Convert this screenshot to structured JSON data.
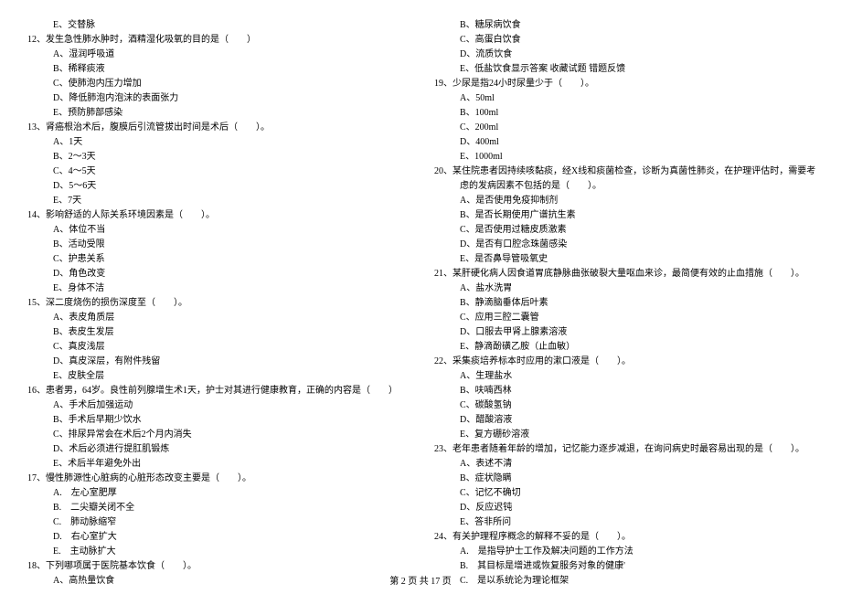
{
  "left_column": [
    {
      "type": "option",
      "text": "E、交替脉"
    },
    {
      "type": "question",
      "text": "12、发生急性肺水肿时，酒精湿化吸氧的目的是（　　）"
    },
    {
      "type": "option",
      "text": "A、湿润呼吸道"
    },
    {
      "type": "option",
      "text": "B、稀释痰液"
    },
    {
      "type": "option",
      "text": "C、使肺泡内压力增加"
    },
    {
      "type": "option",
      "text": "D、降低肺泡内泡沫的表面张力"
    },
    {
      "type": "option",
      "text": "E、预防肺部感染"
    },
    {
      "type": "question",
      "text": "13、肾癌根治术后，腹膜后引流管拔出时间是术后（　　）。"
    },
    {
      "type": "option",
      "text": "A、1天"
    },
    {
      "type": "option",
      "text": "B、2～3天"
    },
    {
      "type": "option",
      "text": "C、4～5天"
    },
    {
      "type": "option",
      "text": "D、5～6天"
    },
    {
      "type": "option",
      "text": "E、7天"
    },
    {
      "type": "question",
      "text": "14、影响舒适的人际关系环境因素是（　　）。"
    },
    {
      "type": "option",
      "text": "A、体位不当"
    },
    {
      "type": "option",
      "text": "B、活动受限"
    },
    {
      "type": "option",
      "text": "C、护患关系"
    },
    {
      "type": "option",
      "text": "D、角色改变"
    },
    {
      "type": "option",
      "text": "E、身体不洁"
    },
    {
      "type": "question",
      "text": "15、深二度烧伤的损伤深度至（　　）。"
    },
    {
      "type": "option",
      "text": "A、表皮角质层"
    },
    {
      "type": "option",
      "text": "B、表皮生发层"
    },
    {
      "type": "option",
      "text": "C、真皮浅层"
    },
    {
      "type": "option",
      "text": "D、真皮深层，有附件残留"
    },
    {
      "type": "option",
      "text": "E、皮肤全层"
    },
    {
      "type": "question",
      "text": "16、患者男，64岁。良性前列腺增生术1天，护士对其进行健康教育，正确的内容是（　　）"
    },
    {
      "type": "option",
      "text": "A、手术后加强运动"
    },
    {
      "type": "option",
      "text": "B、手术后早期少饮水"
    },
    {
      "type": "option",
      "text": "C、排尿异常会在术后2个月内消失"
    },
    {
      "type": "option",
      "text": "D、术后必须进行提肛肌锻炼"
    },
    {
      "type": "option",
      "text": "E、术后半年避免外出"
    },
    {
      "type": "question",
      "text": "17、慢性肺源性心脏病的心脏形态改变主要是（　　）。"
    },
    {
      "type": "option",
      "text": "A.　左心室肥厚"
    },
    {
      "type": "option",
      "text": "B.　二尖瓣关闭不全"
    },
    {
      "type": "option",
      "text": "C.　肺动脉缩窄"
    },
    {
      "type": "option",
      "text": "D.　右心室扩大"
    },
    {
      "type": "option",
      "text": "E.　主动脉扩大"
    },
    {
      "type": "question",
      "text": "18、下列哪项属于医院基本饮食（　　）。"
    },
    {
      "type": "option",
      "text": "A、高热量饮食"
    }
  ],
  "right_column": [
    {
      "type": "option",
      "text": "B、糖尿病饮食"
    },
    {
      "type": "option",
      "text": "C、高蛋白饮食"
    },
    {
      "type": "option",
      "text": "D、流质饮食"
    },
    {
      "type": "option",
      "text": "E、低盐饮食显示答案 收藏试题 错题反馈"
    },
    {
      "type": "question",
      "text": "19、少尿是指24小时尿量少于（　　）。"
    },
    {
      "type": "option",
      "text": "A、50ml"
    },
    {
      "type": "option",
      "text": "B、100ml"
    },
    {
      "type": "option",
      "text": "C、200ml"
    },
    {
      "type": "option",
      "text": "D、400ml"
    },
    {
      "type": "option",
      "text": "E、1000ml"
    },
    {
      "type": "question",
      "text": "20、某住院患者因持续咳黏痰，经X线和痰菌检查，诊断为真菌性肺炎，在护理评估时，需要考"
    },
    {
      "type": "sub",
      "text": "虑的发病因素不包括的是（　　）。"
    },
    {
      "type": "option",
      "text": "A、是否使用免疫抑制剂"
    },
    {
      "type": "option",
      "text": "B、是否长期使用广谱抗生素"
    },
    {
      "type": "option",
      "text": "C、是否使用过糖皮质激素"
    },
    {
      "type": "option",
      "text": "D、是否有口腔念珠菌感染"
    },
    {
      "type": "option",
      "text": "E、是否鼻导管吸氧史"
    },
    {
      "type": "question",
      "text": "21、某肝硬化病人因食道胃底静脉曲张破裂大量呕血来诊，最简便有效的止血措施（　　）。"
    },
    {
      "type": "option",
      "text": "A、盐水洗胃"
    },
    {
      "type": "option",
      "text": "B、静滴脑垂体后叶素"
    },
    {
      "type": "option",
      "text": "C、应用三腔二囊管"
    },
    {
      "type": "option",
      "text": "D、口服去甲肾上腺素溶液"
    },
    {
      "type": "option",
      "text": "E、静滴酚磺乙胺（止血敏）"
    },
    {
      "type": "question",
      "text": "22、采集痰培养标本时应用的漱口液是（　　）。"
    },
    {
      "type": "option",
      "text": "A、生理盐水"
    },
    {
      "type": "option",
      "text": "B、呋喃西林"
    },
    {
      "type": "option",
      "text": "C、碳酸氢钠"
    },
    {
      "type": "option",
      "text": "D、醋酸溶液"
    },
    {
      "type": "option",
      "text": "E、复方硼砂溶液"
    },
    {
      "type": "question",
      "text": "23、老年患者随着年龄的增加，记忆能力逐步减退，在询问病史时最容易出现的是（　　）。"
    },
    {
      "type": "option",
      "text": "A、表述不清"
    },
    {
      "type": "option",
      "text": "B、症状隐瞒"
    },
    {
      "type": "option",
      "text": "C、记忆不确切"
    },
    {
      "type": "option",
      "text": "D、反应迟钝"
    },
    {
      "type": "option",
      "text": "E、答非所问"
    },
    {
      "type": "question",
      "text": "24、有关护理程序概念的解释不妥的是（　　）。"
    },
    {
      "type": "option",
      "text": "A.　是指导护士工作及解决问题的工作方法"
    },
    {
      "type": "option",
      "text": "B.　其目标是增进或恢复服务对象的健康'"
    },
    {
      "type": "option",
      "text": "C.　是以系统论为理论框架"
    }
  ],
  "footer": "第 2 页 共 17 页"
}
